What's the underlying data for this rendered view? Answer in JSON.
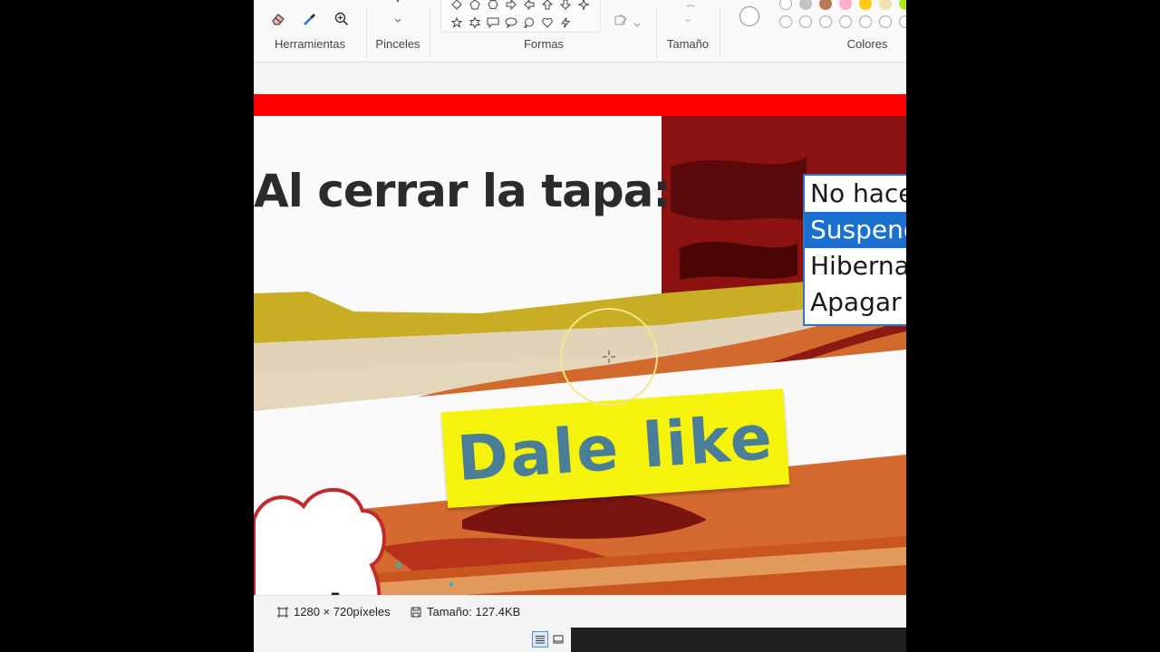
{
  "ribbon": {
    "groups": {
      "tools": "Herramientas",
      "brushes": "Pinceles",
      "shapes": "Formas",
      "size": "Tamaño",
      "colors": "Colores"
    },
    "tool_icons": [
      "eraser-icon",
      "color-picker-icon",
      "magnifier-icon"
    ],
    "shape_icons_row1": [
      "diamond",
      "pentagon",
      "hexagon",
      "arrow-right",
      "arrow-left",
      "arrow-up",
      "arrow-down",
      "star-4"
    ],
    "shape_icons_row2": [
      "star-5",
      "star-6",
      "callout-rect",
      "callout-oval",
      "callout-cloud",
      "heart",
      "lightning"
    ],
    "palette_row1": [
      "#c3c3c3",
      "#b97a57",
      "#ffaec9",
      "#ffc90e",
      "#efe4b0",
      "#b5e61d"
    ]
  },
  "canvas": {
    "lid_label": "Al cerrar la tapa:",
    "dropdown_options": [
      "No hacer",
      "Suspender",
      "Hibernar",
      "Apagar"
    ],
    "selected_option": "Suspender",
    "banner_text": "Dale like",
    "cloud_text": "porte"
  },
  "status": {
    "dimensions": "1280 × 720píxeles",
    "file_size": "Tamaño: 127.4KB"
  },
  "colors": {
    "accent_blue": "#1a6fd0",
    "banner_yellow": "#f5f20c",
    "red_band": "#ff0000"
  }
}
